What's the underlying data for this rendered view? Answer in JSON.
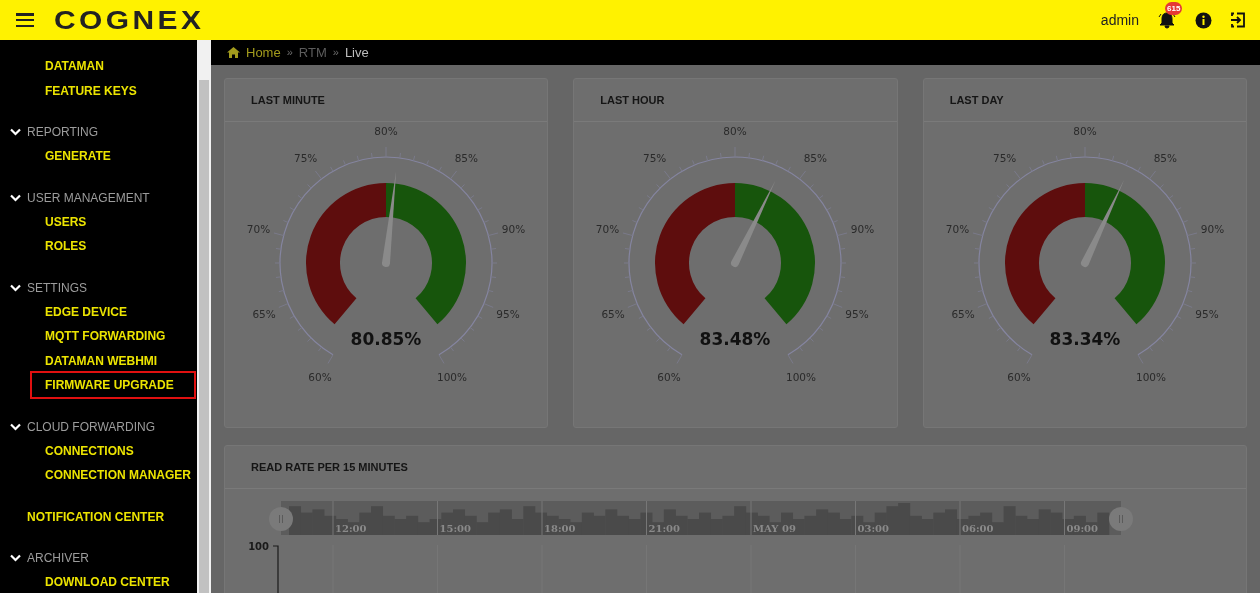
{
  "header": {
    "logo": "COGNEX",
    "user": "admin",
    "notification_count": "615"
  },
  "sidebar": {
    "groups": [
      {
        "children": [
          {
            "label": "DATAMAN",
            "highlighted": false
          },
          {
            "label": "FEATURE KEYS",
            "highlighted": false
          }
        ]
      },
      {
        "label": "REPORTING",
        "expanded": true,
        "children": [
          {
            "label": "GENERATE",
            "highlighted": false
          }
        ]
      },
      {
        "label": "USER MANAGEMENT",
        "expanded": true,
        "children": [
          {
            "label": "USERS",
            "highlighted": false
          },
          {
            "label": "ROLES",
            "highlighted": false
          }
        ]
      },
      {
        "label": "SETTINGS",
        "expanded": true,
        "children": [
          {
            "label": "EDGE DEVICE",
            "highlighted": false
          },
          {
            "label": "MQTT FORWARDING",
            "highlighted": false
          },
          {
            "label": "DATAMAN WEBHMI",
            "highlighted": false
          },
          {
            "label": "FIRMWARE UPGRADE",
            "highlighted": true
          }
        ]
      },
      {
        "label": "CLOUD FORWARDING",
        "expanded": true,
        "children": [
          {
            "label": "CONNECTIONS",
            "highlighted": false
          },
          {
            "label": "CONNECTION MANAGER",
            "highlighted": false
          }
        ]
      },
      {
        "item": "NOTIFICATION CENTER"
      },
      {
        "label": "ARCHIVER",
        "expanded": true,
        "children": [
          {
            "label": "DOWNLOAD CENTER",
            "highlighted": false
          }
        ]
      }
    ]
  },
  "breadcrumb": [
    "Home",
    "RTM",
    "Live"
  ],
  "breadcrumb_separators": [
    "»",
    "»"
  ],
  "gauges": [
    {
      "title": "LAST MINUTE",
      "value": "80.85%",
      "level": 0.521,
      "scale": [
        "60%",
        "65%",
        "70%",
        "75%",
        "80%",
        "85%",
        "90%",
        "95%",
        "100%"
      ]
    },
    {
      "title": "LAST HOUR",
      "value": "83.48%",
      "level": 0.587,
      "scale": [
        "60%",
        "65%",
        "70%",
        "75%",
        "80%",
        "85%",
        "90%",
        "95%",
        "100%"
      ]
    },
    {
      "title": "LAST DAY",
      "value": "83.34%",
      "level": 0.584,
      "scale": [
        "60%",
        "65%",
        "70%",
        "75%",
        "80%",
        "85%",
        "90%",
        "95%",
        "100%"
      ]
    }
  ],
  "read_rate": {
    "title": "READ RATE PER 15 MINUTES",
    "time_labels": [
      "12:00",
      "15:00",
      "18:00",
      "21:00",
      "MAY 09",
      "03:00",
      "06:00",
      "09:00"
    ],
    "y_label": "100"
  }
}
